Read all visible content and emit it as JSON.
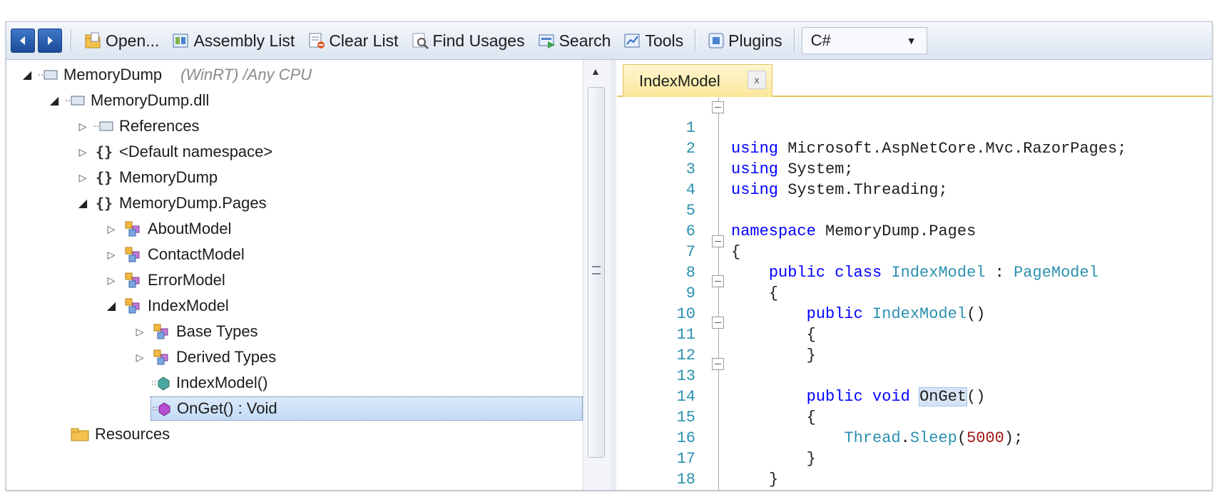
{
  "toolbar": {
    "back_icon": "back-arrow-icon",
    "forward_icon": "forward-arrow-icon",
    "open_label": "Open...",
    "assembly_list_label": "Assembly List",
    "clear_list_label": "Clear List",
    "find_usages_label": "Find Usages",
    "search_label": "Search",
    "tools_label": "Tools",
    "plugins_label": "Plugins",
    "language_selected": "C#"
  },
  "tree": {
    "assembly_name": "MemoryDump",
    "assembly_info": "(WinRT) /Any CPU",
    "dll_name": "MemoryDump.dll",
    "references": "References",
    "default_namespace": "<Default namespace>",
    "ns_memorydump": "MemoryDump",
    "ns_pages": "MemoryDump.Pages",
    "about_model": "AboutModel",
    "contact_model": "ContactModel",
    "error_model": "ErrorModel",
    "index_model": "IndexModel",
    "base_types": "Base Types",
    "derived_types": "Derived Types",
    "ctor": "IndexModel()",
    "onget": "OnGet() : Void",
    "resources": "Resources"
  },
  "editor": {
    "tab_label": "IndexModel",
    "tab_close": "x",
    "lines": [
      "1",
      "2",
      "3",
      "4",
      "5",
      "6",
      "7",
      "8",
      "9",
      "10",
      "11",
      "12",
      "13",
      "14",
      "15",
      "16",
      "17",
      "18"
    ],
    "code": {
      "kw_using": "using",
      "ns_aspnet": " Microsoft.AspNetCore.Mvc.RazorPages;",
      "ns_system": " System;",
      "ns_threading": " System.Threading;",
      "kw_namespace": "namespace",
      "ns_pages": " MemoryDump.Pages",
      "open_brace": "{",
      "close_brace": "}",
      "kw_public": "public",
      "kw_class": "class",
      "class_name": "IndexModel",
      "colon": " : ",
      "base_class": "PageModel",
      "ctor_name": "IndexModel",
      "parens": "()",
      "kw_void": "void",
      "method_name": "OnGet",
      "thread": "Thread",
      "dot": ".",
      "sleep": "Sleep",
      "open_paren": "(",
      "sleep_arg": "5000",
      "close_stmt": ");"
    }
  },
  "colors": {
    "keyword": "#0000ff",
    "type": "#2b91af",
    "number": "#a31515",
    "tab_bg": "#fbe79a",
    "selection": "#c4dbf6"
  }
}
